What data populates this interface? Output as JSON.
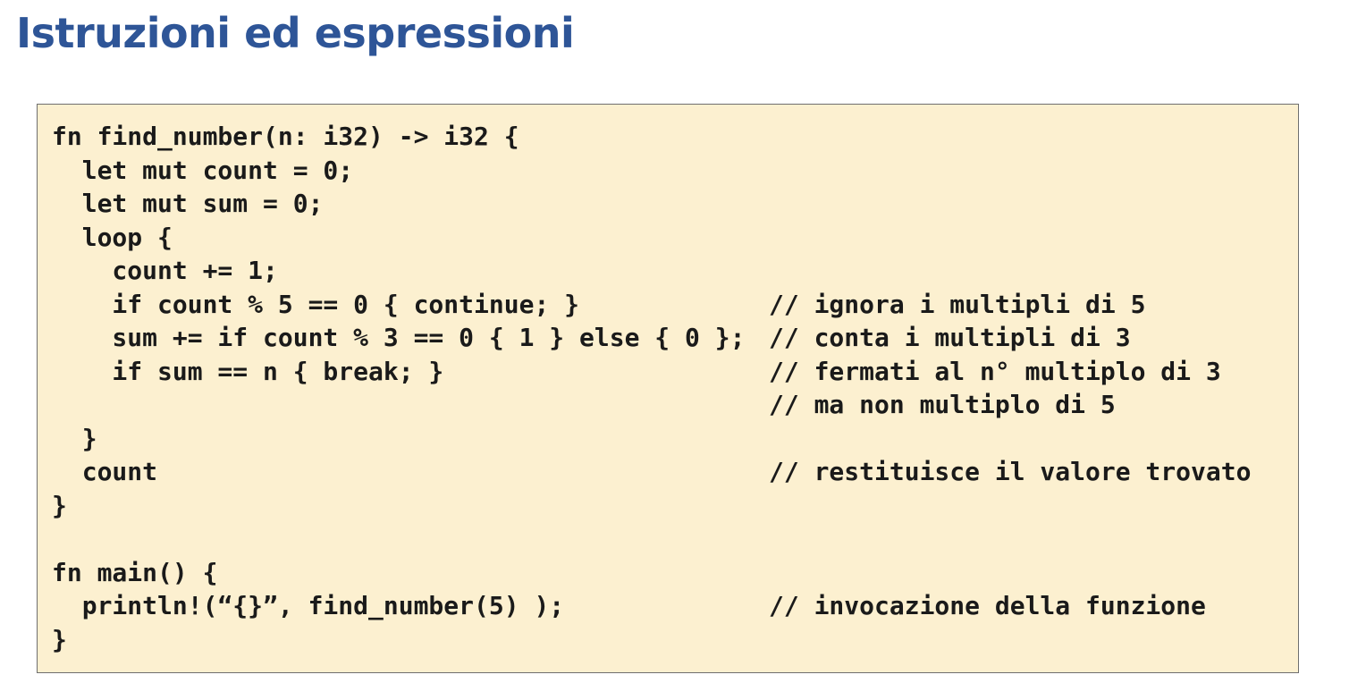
{
  "slide": {
    "title": "Istruzioni ed espressioni"
  },
  "code_block": {
    "language": "rust",
    "lines": [
      {
        "code": "fn find_number(n: i32) -> i32 {",
        "comment": ""
      },
      {
        "code": "  let mut count = 0;",
        "comment": ""
      },
      {
        "code": "  let mut sum = 0;",
        "comment": ""
      },
      {
        "code": "  loop {",
        "comment": ""
      },
      {
        "code": "    count += 1;",
        "comment": ""
      },
      {
        "code": "    if count % 5 == 0 { continue; }",
        "comment": "// ignora i multipli di 5"
      },
      {
        "code": "    sum += if count % 3 == 0 { 1 } else { 0 };",
        "comment": "// conta i multipli di 3"
      },
      {
        "code": "    if sum == n { break; }",
        "comment": "// fermati al n° multiplo di 3"
      },
      {
        "code": "",
        "comment": "// ma non multiplo di 5"
      },
      {
        "code": "  }",
        "comment": ""
      },
      {
        "code": "  count",
        "comment": "// restituisce il valore trovato"
      },
      {
        "code": "}",
        "comment": ""
      },
      {
        "code": "",
        "comment": ""
      },
      {
        "code": "fn main() {",
        "comment": ""
      },
      {
        "code": "  println!(“{}”, find_number(5) );",
        "comment": "// invocazione della funzione"
      },
      {
        "code": "}",
        "comment": ""
      }
    ]
  }
}
